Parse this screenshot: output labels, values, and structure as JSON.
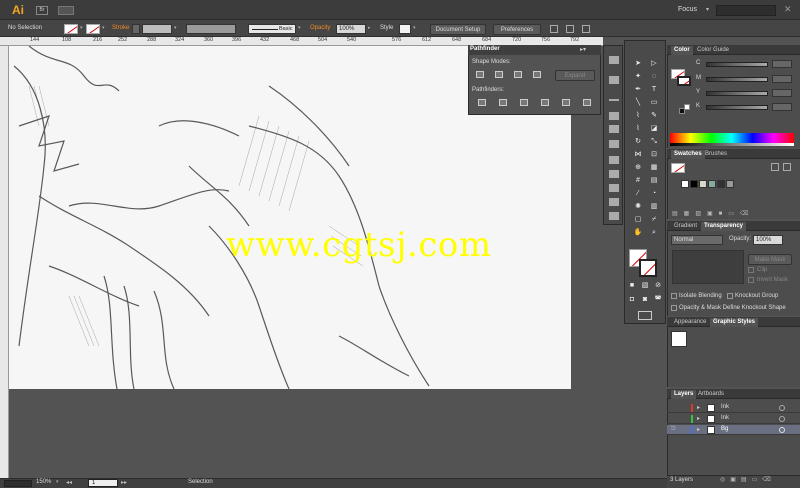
{
  "menubar": {
    "app_logo": "Ai",
    "bridge_label": "Br",
    "workspace": "Focus",
    "close_glyph": "✕"
  },
  "control_bar": {
    "selection": "No Selection",
    "stroke_label": "Stroke",
    "profile": "Basic",
    "opacity_label": "Opacity",
    "opacity_value": "100%",
    "style_label": "Style",
    "document_setup": "Document Setup",
    "preferences": "Preferences"
  },
  "ruler": {
    "ticks": [
      "144",
      "108",
      "216",
      "252",
      "288",
      "324",
      "360",
      "396",
      "432",
      "468",
      "504",
      "540",
      "576",
      "612",
      "648",
      "684",
      "720",
      "756",
      "792"
    ]
  },
  "canvas": {
    "watermark": "www.cgtsj.com"
  },
  "pathfinder": {
    "title": "Pathfinder",
    "shape_modes": "Shape Modes:",
    "expand": "Expand",
    "pathfinders": "Pathfinders:"
  },
  "color_panel": {
    "tabs": [
      "Color",
      "Color Guide"
    ],
    "channels": [
      "C",
      "M",
      "Y",
      "K"
    ]
  },
  "swatches_panel": {
    "tabs": [
      "Swatches",
      "Brushes"
    ]
  },
  "transparency_panel": {
    "tabs": [
      "Gradient",
      "Transparency"
    ],
    "blend_mode": "Normal",
    "opacity_label": "Opacity:",
    "opacity_value": "100%",
    "make_mask": "Make Mask",
    "clip": "Clip",
    "invert_mask": "Invert Mask",
    "isolate_blending": "Isolate Blending",
    "knockout_group": "Knockout Group",
    "opacity_mask": "Opacity & Mask Define Knockout Shape"
  },
  "appearance_panel": {
    "tabs": [
      "Appearance",
      "Graphic Styles"
    ]
  },
  "layers_panel": {
    "tabs": [
      "Layers",
      "Artboards"
    ],
    "layers": [
      {
        "name": "Ink",
        "color": "#e0382d"
      },
      {
        "name": "Ink",
        "color": "#3ac43a"
      },
      {
        "name": "Bg",
        "color": "#4a6ee0"
      }
    ],
    "count": "3 Layers"
  },
  "status_bar": {
    "zoom": "150%",
    "artboard": "1",
    "tool": "Selection"
  },
  "colors": {
    "accent_orange": "#f08a24",
    "watermark_yellow": "#ffff00",
    "selected_layer": "#6a6f82"
  }
}
